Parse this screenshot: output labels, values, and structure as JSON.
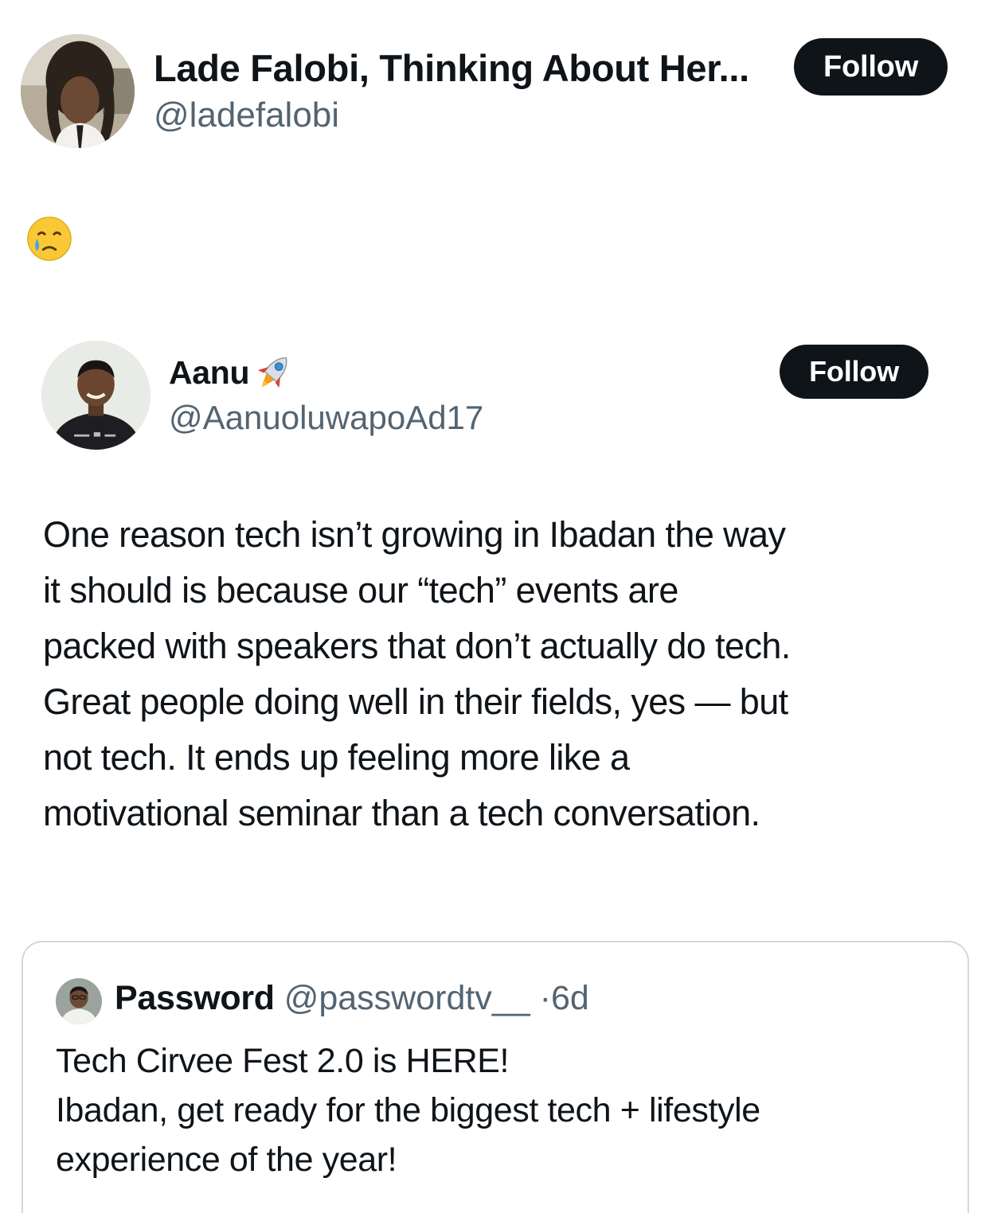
{
  "top_post": {
    "display_name": "Lade Falobi, Thinking About Her...",
    "handle": "@ladefalobi",
    "follow_label": "Follow",
    "body_emoji": "face-holding-back-tears"
  },
  "quoted_post": {
    "display_name": "Aanu",
    "name_emoji": "rocket",
    "handle": "@AanuoluwapoAd17",
    "follow_label": "Follow",
    "body_lines": [
      "One reason tech isn’t growing in Ibadan the way",
      "it should is because our “tech” events are",
      "packed with speakers that don’t actually do tech.",
      "Great people doing well in their fields, yes — but",
      "not tech. It ends up feeling more like a",
      "motivational seminar than a tech conversation."
    ]
  },
  "nested_quote": {
    "display_name": "Password",
    "handle": "@passwordtv__",
    "separator": "·",
    "time": "6d",
    "body_lines": [
      "Tech Cirvee Fest 2.0 is HERE!",
      "Ibadan, get ready for the biggest tech + lifestyle",
      "experience of the year!"
    ]
  },
  "colors": {
    "text_primary": "#0f1419",
    "text_secondary": "#536471",
    "button_bg": "#0f1419",
    "button_text": "#ffffff",
    "card_border": "#cfd9de"
  }
}
